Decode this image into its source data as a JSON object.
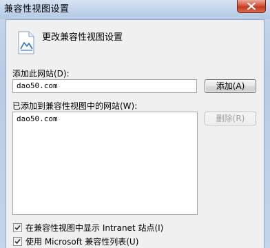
{
  "window": {
    "title": "兼容性视图设置"
  },
  "header": {
    "text": "更改兼容性视图设置"
  },
  "add_section": {
    "label": "添加此网站(D):",
    "input_value": "dao50.com",
    "add_button": "添加(A)"
  },
  "list_section": {
    "label": "已添加到兼容性视图中的网站(W):",
    "items": [
      "dao50.com"
    ],
    "remove_button": "删除(R)"
  },
  "options": {
    "intranet_label": "在兼容性视图中显示 Intranet 站点(I)",
    "intranet_checked": true,
    "microsoft_list_label": "使用 Microsoft 兼容性列表(U)",
    "microsoft_list_checked": true
  }
}
